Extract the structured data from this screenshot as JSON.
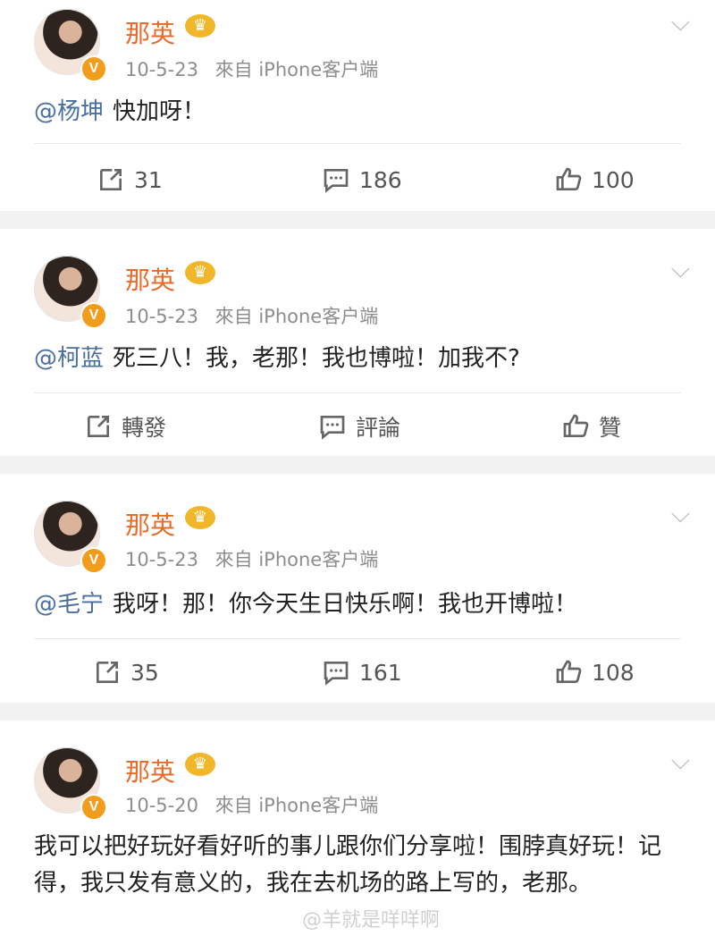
{
  "posts": [
    {
      "author": "那英",
      "time": "10-5-23",
      "source": "來自 iPhone客户端",
      "mention": "@杨坤",
      "text": "快加呀！",
      "repost": "31",
      "comment": "186",
      "like": "100"
    },
    {
      "author": "那英",
      "time": "10-5-23",
      "source": "來自 iPhone客户端",
      "mention": "@柯蓝",
      "text": "死三八！我，老那！我也博啦！加我不?",
      "repost": "轉發",
      "comment": "評論",
      "like": "贊"
    },
    {
      "author": "那英",
      "time": "10-5-23",
      "source": "來自 iPhone客户端",
      "mention": "@毛宁",
      "text": "我呀！那！你今天生日快乐啊！我也开博啦！",
      "repost": "35",
      "comment": "161",
      "like": "108"
    },
    {
      "author": "那英",
      "time": "10-5-20",
      "source": "來自 iPhone客户端",
      "mention": "",
      "text": "我可以把好玩好看好听的事儿跟你们分享啦！围脖真好玩！记得，我只发有意义的，我在去机场的路上写的，老那。"
    }
  ],
  "watermark": "@羊就是咩咩啊",
  "icons": [
    "crown-icon",
    "chevron-down-icon",
    "repost-icon",
    "comment-icon",
    "like-icon",
    "verified-icon"
  ],
  "colors": {
    "name": "#e96b2a",
    "mention": "#4a6f9e",
    "meta": "#8d8d8d",
    "badge": "#f19c1b"
  }
}
